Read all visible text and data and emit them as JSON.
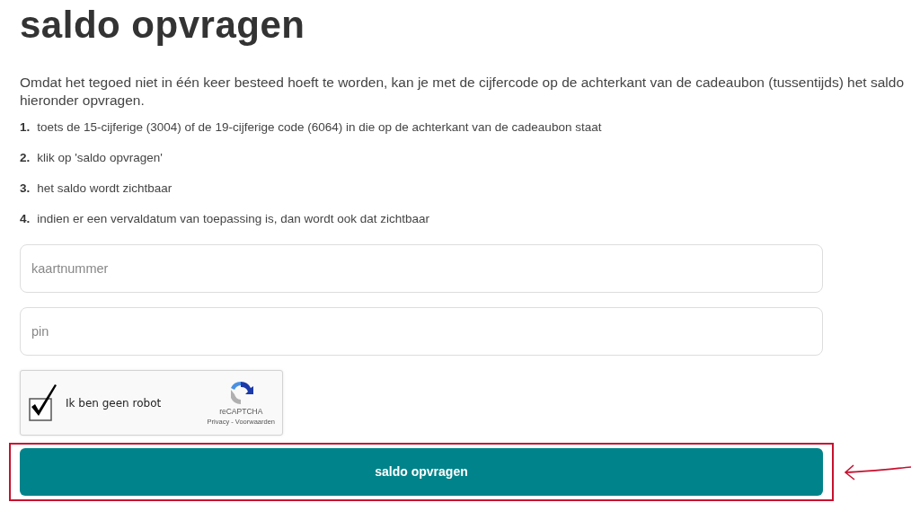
{
  "heading": "saldo opvragen",
  "intro": "Omdat het tegoed niet in één keer besteed hoeft te worden, kan je met de cijfercode op de achterkant van de cadeaubon (tussentijds) het saldo hieronder opvragen.",
  "steps": [
    {
      "number": "1.",
      "text": "toets de 15-cijferige (3004) of de 19-cijferige code (6064) in die op de achterkant van de cadeaubon staat"
    },
    {
      "number": "2.",
      "text": "klik op 'saldo opvragen'"
    },
    {
      "number": "3.",
      "text": "het saldo wordt zichtbaar"
    },
    {
      "number": "4.",
      "text": "indien er een vervaldatum van toepassing is, dan wordt ook dat zichtbaar"
    }
  ],
  "fields": [
    {
      "placeholder": "kaartnummer"
    },
    {
      "placeholder": "pin"
    }
  ],
  "captcha": {
    "label": "Ik ben geen robot",
    "checked": true,
    "brand": "reCAPTCHA",
    "links": "Privacy - Voorwaarden"
  },
  "submit": {
    "label": "saldo opvragen",
    "highlighted": true
  }
}
